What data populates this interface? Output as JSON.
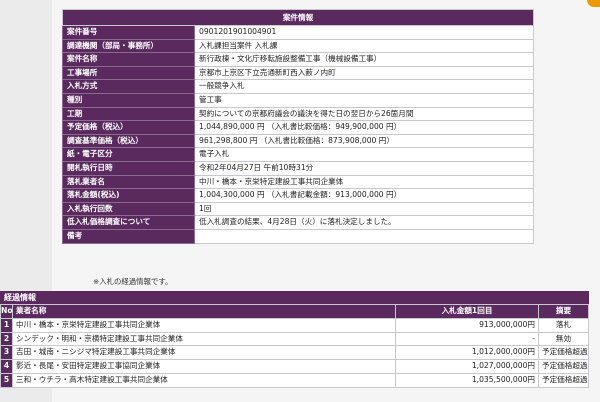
{
  "case_info": {
    "title": "案件情報",
    "rows": [
      {
        "label": "案件番号",
        "value": "0901201901004901"
      },
      {
        "label": "調達機関（部局・事務所）",
        "value": "入札課担当案件 入札課"
      },
      {
        "label": "案件名称",
        "value": "新行政棟・文化庁移転施設整備工事（機械設備工事）"
      },
      {
        "label": "工事場所",
        "value": "京都市上京区下立売通新町西入薮ノ内町"
      },
      {
        "label": "入札方式",
        "value": "一般競争入札"
      },
      {
        "label": "種別",
        "value": "管工事"
      },
      {
        "label": "工期",
        "value": "契約についての京都府議会の議決を得た日の翌日から26箇月間"
      },
      {
        "label": "予定価格（税込）",
        "value": "1,044,890,000 円 （入札書比較価格：949,900,000 円）"
      },
      {
        "label": "調査基準価格（税込）",
        "value": "961,298,800 円 （入札書比較価格：873,908,000 円）"
      },
      {
        "label": "紙・電子区分",
        "value": "電子入札"
      },
      {
        "label": "開札執行日時",
        "value": "令和2年04月27日 午前10時31分"
      },
      {
        "label": "落札業者名",
        "value": "中川・橋本・京栄特定建設工事共同企業体"
      },
      {
        "label": "落札金額(税込)",
        "value": "1,004,300,000 円 （入札書記載金額：913,000,000 円）"
      },
      {
        "label": "入札執行回数",
        "value": "1回"
      },
      {
        "label": "低入札価格調査について",
        "value": "低入札調査の結果、4月28日（火）に落札決定しました。"
      },
      {
        "label": "備考",
        "value": ""
      }
    ]
  },
  "note": "※入札の経過情報です。",
  "progress": {
    "title": "経過情報",
    "headers": {
      "no": "No.",
      "name": "業者名称",
      "amount": "入札金額1回目",
      "result": "摘要"
    },
    "rows": [
      {
        "no": "1",
        "name": "中川・橋本・京栄特定建設工事共同企業体",
        "amount": "913,000,000円",
        "result": "落札"
      },
      {
        "no": "2",
        "name": "シンデック・明和・京横特定建設工事共同企業体",
        "amount": "-",
        "result": "無効"
      },
      {
        "no": "3",
        "name": "吉田・城南・ニシジマ特定建設工事共同企業体",
        "amount": "1,012,000,000円",
        "result": "予定価格超過"
      },
      {
        "no": "4",
        "name": "影近・長尾・安田特定建設工事協同企業体",
        "amount": "1,027,000,000円",
        "result": "予定価格超過"
      },
      {
        "no": "5",
        "name": "三和・ウチラ・高木特定建設工事共同企業体",
        "amount": "1,035,500,000円",
        "result": "予定価格超過"
      }
    ]
  },
  "colors": {
    "header_purple": "#5a2a5f",
    "scroll_orange": "#e89a00"
  }
}
